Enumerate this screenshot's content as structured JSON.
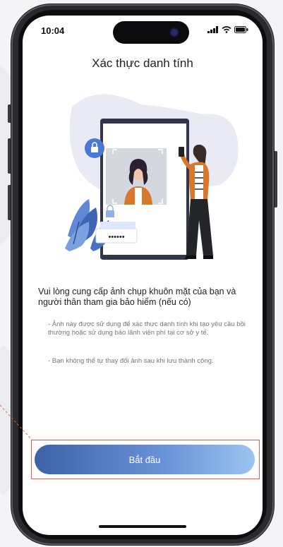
{
  "status_bar": {
    "time": "10:04"
  },
  "page": {
    "title": "Xác thực danh tính"
  },
  "instructions": {
    "main": "Vui lòng cung cấp ảnh chụp khuôn mặt của bạn và người thân tham gia bảo hiểm (nếu có)",
    "notes": [
      "- Ảnh này được sử dụng để xác thực danh tính khi tạo yêu cầu bồi thường hoặc sử dụng bảo lãnh viện phí tại cơ sở y tế.",
      "- Bạn không thể tự thay đổi ảnh sau khi lưu thành công."
    ]
  },
  "actions": {
    "start_label": "Bắt đầu"
  },
  "colors": {
    "button_start": "#3d62a6",
    "button_end": "#9cc4f0",
    "highlight": "#e0614f",
    "accent_blue": "#4a78d8",
    "jacket": "#d9772c"
  }
}
